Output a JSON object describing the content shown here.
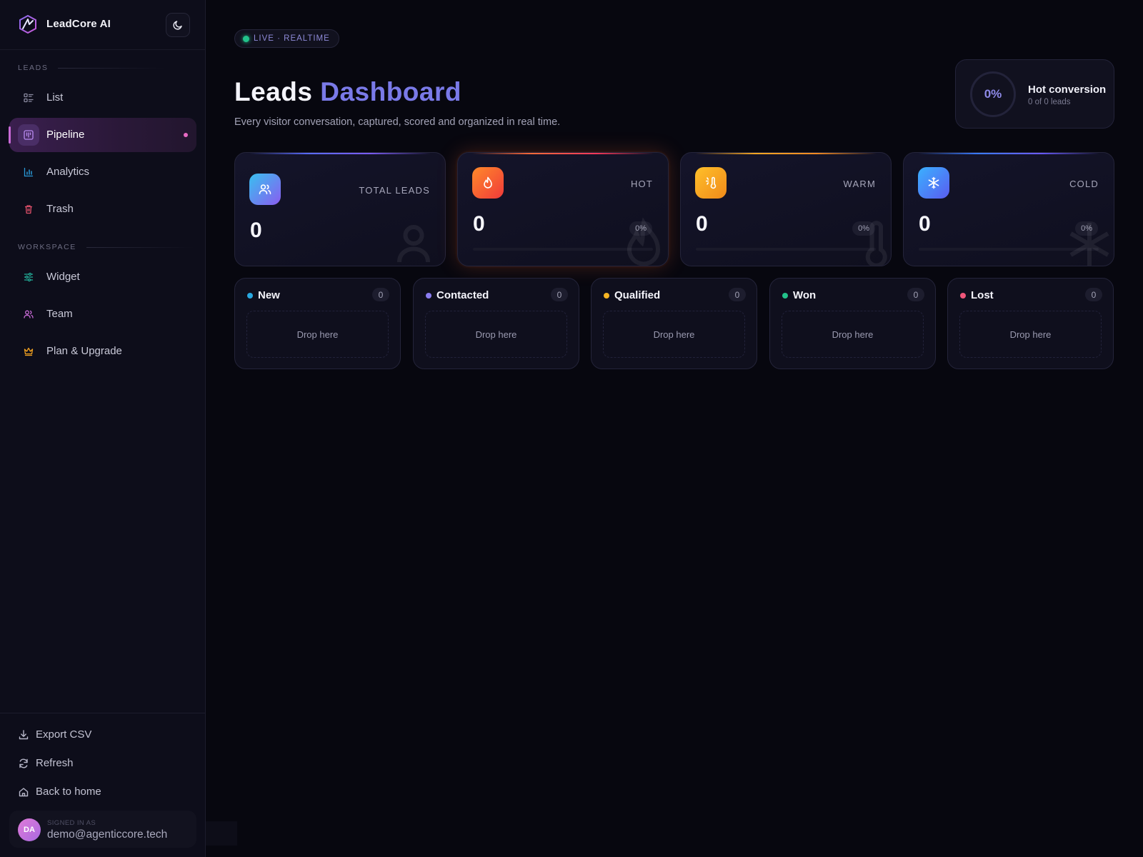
{
  "brand": {
    "name": "LeadCore AI"
  },
  "sidebar": {
    "sections": {
      "leads": "LEADS",
      "workspace": "WORKSPACE"
    },
    "leads_items": [
      {
        "label": "List",
        "icon": "list-icon"
      },
      {
        "label": "Pipeline",
        "icon": "kanban-icon",
        "active": true
      },
      {
        "label": "Analytics",
        "icon": "bar-chart-icon"
      },
      {
        "label": "Trash",
        "icon": "trash-icon"
      }
    ],
    "workspace_items": [
      {
        "label": "Widget",
        "icon": "sliders-icon"
      },
      {
        "label": "Team",
        "icon": "users-icon"
      },
      {
        "label": "Plan & Upgrade",
        "icon": "crown-icon"
      }
    ],
    "footer_links": [
      {
        "label": "Export CSV",
        "icon": "download-icon"
      },
      {
        "label": "Refresh",
        "icon": "refresh-icon"
      },
      {
        "label": "Back to home",
        "icon": "home-icon"
      }
    ],
    "user": {
      "initials": "DA",
      "signed_in_label": "SIGNED IN AS",
      "email": "demo@agenticcore.tech"
    }
  },
  "header": {
    "live_badge": "LIVE · REALTIME",
    "title_main": "Leads",
    "title_accent": "Dashboard",
    "subtitle": "Every visitor conversation, captured, scored and organized in real time."
  },
  "conversion": {
    "value": "0%",
    "title": "Hot conversion",
    "subtitle": "0 of 0 leads"
  },
  "stats": [
    {
      "label": "TOTAL LEADS",
      "value": "0",
      "icon": "users-icon",
      "accent": "#6a5cff"
    },
    {
      "label": "HOT",
      "value": "0",
      "percent": "0%",
      "icon": "flame-icon",
      "accent": "#ff5a2e"
    },
    {
      "label": "WARM",
      "value": "0",
      "percent": "0%",
      "icon": "thermometer-sun-icon",
      "accent": "#f5a623"
    },
    {
      "label": "COLD",
      "value": "0",
      "percent": "0%",
      "icon": "snowflake-icon",
      "accent": "#3a7bff"
    }
  ],
  "pipeline": [
    {
      "name": "New",
      "count": "0",
      "drop": "Drop here",
      "color": "#29a8e0"
    },
    {
      "name": "Contacted",
      "count": "0",
      "drop": "Drop here",
      "color": "#8a7cf0"
    },
    {
      "name": "Qualified",
      "count": "0",
      "drop": "Drop here",
      "color": "#f5b423"
    },
    {
      "name": "Won",
      "count": "0",
      "drop": "Drop here",
      "color": "#22c28a"
    },
    {
      "name": "Lost",
      "count": "0",
      "drop": "Drop here",
      "color": "#f0567a"
    }
  ]
}
